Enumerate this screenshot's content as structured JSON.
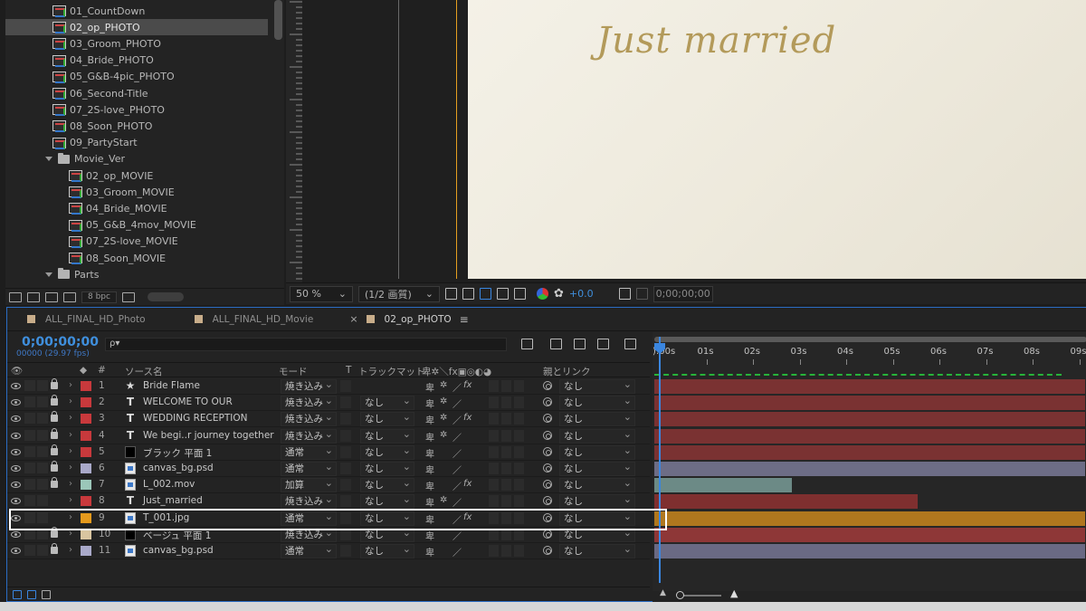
{
  "project": {
    "items": [
      {
        "label": "01_CountDown",
        "kind": "comp",
        "indent": 1,
        "selected": false
      },
      {
        "label": "02_op_PHOTO",
        "kind": "comp",
        "indent": 1,
        "selected": true
      },
      {
        "label": "03_Groom_PHOTO",
        "kind": "comp",
        "indent": 1,
        "selected": false
      },
      {
        "label": "04_Bride_PHOTO",
        "kind": "comp",
        "indent": 1,
        "selected": false
      },
      {
        "label": "05_G&B-4pic_PHOTO",
        "kind": "comp",
        "indent": 1,
        "selected": false
      },
      {
        "label": "06_Second-Title",
        "kind": "comp",
        "indent": 1,
        "selected": false
      },
      {
        "label": "07_2S-love_PHOTO",
        "kind": "comp",
        "indent": 1,
        "selected": false
      },
      {
        "label": "08_Soon_PHOTO",
        "kind": "comp",
        "indent": 1,
        "selected": false
      },
      {
        "label": "09_PartyStart",
        "kind": "comp",
        "indent": 1,
        "selected": false
      },
      {
        "label": "Movie_Ver",
        "kind": "folder",
        "indent": 0,
        "selected": false
      },
      {
        "label": "02_op_MOVIE",
        "kind": "comp",
        "indent": 2,
        "selected": false
      },
      {
        "label": "03_Groom_MOVIE",
        "kind": "comp",
        "indent": 2,
        "selected": false
      },
      {
        "label": "04_Bride_MOVIE",
        "kind": "comp",
        "indent": 2,
        "selected": false
      },
      {
        "label": "05_G&B_4mov_MOVIE",
        "kind": "comp",
        "indent": 2,
        "selected": false
      },
      {
        "label": "07_2S-love_MOVIE",
        "kind": "comp",
        "indent": 2,
        "selected": false
      },
      {
        "label": "08_Soon_MOVIE",
        "kind": "comp",
        "indent": 2,
        "selected": false
      },
      {
        "label": "Parts",
        "kind": "folder",
        "indent": 0,
        "selected": false
      }
    ],
    "bpc": "8 bpc"
  },
  "viewer": {
    "overlay_text": "Just married",
    "zoom": "50 %",
    "resolution": "(1/2 画質)",
    "exposure": "+0.0",
    "timecode": "0;00;00;00"
  },
  "timeline": {
    "tabs": [
      {
        "label": "ALL_FINAL_HD_Photo",
        "active": false
      },
      {
        "label": "ALL_FINAL_HD_Movie",
        "active": false
      },
      {
        "label": "02_op_PHOTO",
        "active": true
      }
    ],
    "tab_close": "×",
    "tab_menu": "≡",
    "current_time": "0;00;00;00",
    "fps": "00000 (29.97 fps)",
    "search_glyph": "ρ▾",
    "columns": {
      "source_name": "ソース名",
      "mode": "モード",
      "t": "T",
      "track_matte": "トラックマット",
      "parent_link": "親とリンク",
      "num": "#"
    },
    "ruler_ticks": [
      "):00s",
      "01s",
      "02s",
      "03s",
      "04s",
      "05s",
      "06s",
      "07s",
      "08s",
      "09s"
    ],
    "layers": [
      {
        "num": "1",
        "type": "star",
        "type_glyph": "★",
        "name": "Bride Flame",
        "mode": "焼き込み",
        "track": "",
        "fx": true,
        "parent": "なし",
        "label_color": "#c8393c",
        "lock": true
      },
      {
        "num": "2",
        "type": "text",
        "type_glyph": "T",
        "name": "WELCOME TO OUR",
        "mode": "焼き込み",
        "track": "なし",
        "fx": false,
        "parent": "なし",
        "label_color": "#c8393c",
        "lock": true
      },
      {
        "num": "3",
        "type": "text",
        "type_glyph": "T",
        "name": "WEDDING RECEPTION",
        "mode": "焼き込み",
        "track": "なし",
        "fx": true,
        "parent": "なし",
        "label_color": "#c8393c",
        "lock": true
      },
      {
        "num": "4",
        "type": "text",
        "type_glyph": "T",
        "name": "We begi..r journey together",
        "mode": "焼き込み",
        "track": "なし",
        "fx": false,
        "parent": "なし",
        "label_color": "#c8393c",
        "lock": true
      },
      {
        "num": "5",
        "type": "solid",
        "type_glyph": "",
        "name": "ブラック 平面 1",
        "mode": "通常",
        "track": "なし",
        "fx": false,
        "parent": "なし",
        "label_color": "#c8393c",
        "lock": true
      },
      {
        "num": "6",
        "type": "file",
        "type_glyph": "",
        "name": "canvas_bg.psd",
        "mode": "通常",
        "track": "なし",
        "fx": false,
        "parent": "なし",
        "label_color": "#a9a9c9",
        "lock": true
      },
      {
        "num": "7",
        "type": "file",
        "type_glyph": "",
        "name": "L_002.mov",
        "mode": "加算",
        "track": "なし",
        "fx": true,
        "parent": "なし",
        "label_color": "#9bc7b9",
        "lock": true
      },
      {
        "num": "8",
        "type": "text",
        "type_glyph": "T",
        "name": "Just_married",
        "mode": "焼き込み",
        "track": "なし",
        "fx": false,
        "parent": "なし",
        "label_color": "#c8393c",
        "lock": false
      },
      {
        "num": "9",
        "type": "file",
        "type_glyph": "",
        "name": "T_001.jpg",
        "mode": "通常",
        "track": "なし",
        "fx": true,
        "parent": "なし",
        "label_color": "#e59a1d",
        "lock": false
      },
      {
        "num": "10",
        "type": "solid",
        "type_glyph": "",
        "name": "ベージュ 平面 1",
        "mode": "焼き込み",
        "track": "なし",
        "fx": false,
        "parent": "なし",
        "label_color": "#d9c5a0",
        "lock": true
      },
      {
        "num": "11",
        "type": "file",
        "type_glyph": "",
        "name": "canvas_bg.psd",
        "mode": "通常",
        "track": "なし",
        "fx": false,
        "parent": "なし",
        "label_color": "#a9a9c9",
        "lock": true
      }
    ],
    "bars": [
      {
        "row": 0,
        "start": 0.0,
        "end": 9.3,
        "color": "#7a3232"
      },
      {
        "row": 1,
        "start": 0.0,
        "end": 9.3,
        "color": "#7a3232"
      },
      {
        "row": 2,
        "start": 0.0,
        "end": 9.3,
        "color": "#7a3232"
      },
      {
        "row": 3,
        "start": 0.0,
        "end": 9.3,
        "color": "#7a3232"
      },
      {
        "row": 4,
        "start": 0.0,
        "end": 9.3,
        "color": "#7a3232"
      },
      {
        "row": 5,
        "start": 0.0,
        "end": 9.3,
        "color": "#6d6d86"
      },
      {
        "row": 6,
        "start": 0.0,
        "end": 2.95,
        "color": "#6c8a86"
      },
      {
        "row": 7,
        "start": 0.0,
        "end": 5.65,
        "color": "#7f2f2f"
      },
      {
        "row": 8,
        "start": 0.0,
        "end": 9.3,
        "color": "#b0771e"
      },
      {
        "row": 9,
        "start": 0.0,
        "end": 9.3,
        "color": "#8e3737"
      },
      {
        "row": 10,
        "start": 0.0,
        "end": 9.3,
        "color": "#6a6a84"
      }
    ],
    "selected_layer": "9"
  }
}
